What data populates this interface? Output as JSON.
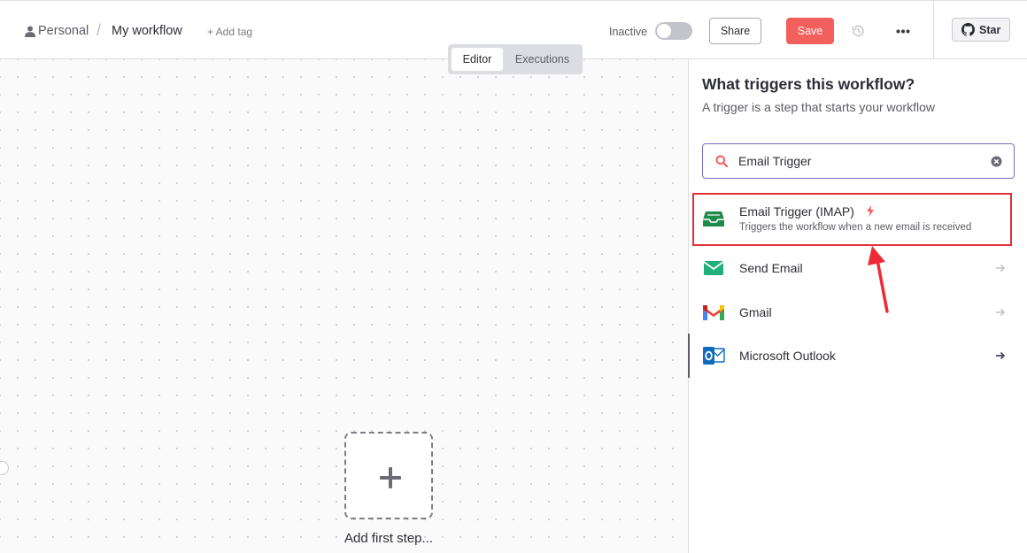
{
  "header": {
    "breadcrumb_personal": "Personal",
    "breadcrumb_separator": "/",
    "workflow_title": "My workflow",
    "add_tag": "+ Add tag",
    "status_label": "Inactive",
    "share_label": "Share",
    "save_label": "Save",
    "star_label": "Star"
  },
  "canvas": {
    "tabs": [
      {
        "label": "Editor",
        "active": true
      },
      {
        "label": "Executions",
        "active": false
      }
    ],
    "add_step_label": "Add first step..."
  },
  "panel": {
    "title": "What triggers this workflow?",
    "subtitle": "A trigger is a step that starts your workflow",
    "search_value": "Email Trigger",
    "results": [
      {
        "name": "Email Trigger (IMAP)",
        "description": "Triggers the workflow when a new email is received",
        "icon": "inbox-icon",
        "badge": "trigger-bolt-icon",
        "highlighted": true
      },
      {
        "name": "Send Email",
        "icon": "envelope-icon"
      },
      {
        "name": "Gmail",
        "icon": "gmail-icon"
      },
      {
        "name": "Microsoft Outlook",
        "icon": "outlook-icon"
      }
    ]
  },
  "colors": {
    "accent": "#f25f5c",
    "highlight_border": "#e5303a",
    "search_border": "#7a6cc0",
    "inbox_green": "#1e8a4c",
    "send_email_green": "#22b07a"
  }
}
